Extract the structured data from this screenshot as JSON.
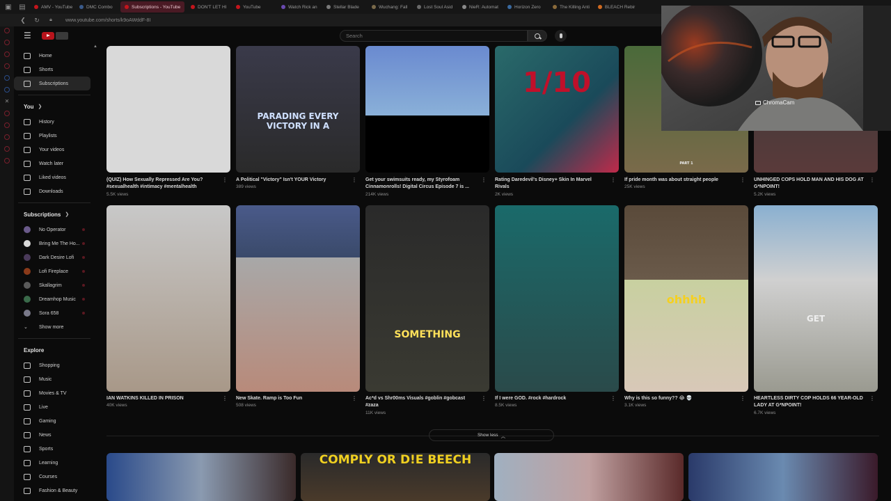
{
  "browser": {
    "tabs": [
      {
        "label": "AMV - YouTube",
        "active": false
      },
      {
        "label": "DMC Combo",
        "active": false
      },
      {
        "label": "Subscriptions - YouTube",
        "active": true
      },
      {
        "label": "DON'T LET HI",
        "active": false
      },
      {
        "label": "YouTube",
        "active": false
      },
      {
        "label": "Watch Rick an",
        "active": false
      },
      {
        "label": "Stellar Blade",
        "active": false
      },
      {
        "label": "Wuchang: Fall",
        "active": false
      },
      {
        "label": "Lost Soul Asid",
        "active": false
      },
      {
        "label": "NieR: Automat",
        "active": false
      },
      {
        "label": "Horizon Zero",
        "active": false
      },
      {
        "label": "The Killing Anti",
        "active": false
      },
      {
        "label": "BLEACH Rebir",
        "active": false
      }
    ],
    "url": "www.youtube.com/shorts/k9oAWddF-8I"
  },
  "header": {
    "search_placeholder": "Search"
  },
  "nav": {
    "main": [
      {
        "label": "Home",
        "icon": "home-icon"
      },
      {
        "label": "Shorts",
        "icon": "shorts-icon"
      },
      {
        "label": "Subscriptions",
        "icon": "subscriptions-icon",
        "selected": true
      }
    ],
    "you_title": "You",
    "you_items": [
      {
        "label": "History",
        "icon": "history-icon"
      },
      {
        "label": "Playlists",
        "icon": "playlists-icon"
      },
      {
        "label": "Your videos",
        "icon": "your-videos-icon"
      },
      {
        "label": "Watch later",
        "icon": "watch-later-icon"
      },
      {
        "label": "Liked videos",
        "icon": "liked-videos-icon"
      },
      {
        "label": "Downloads",
        "icon": "downloads-icon"
      }
    ],
    "subscriptions_title": "Subscriptions",
    "subscriptions": [
      {
        "label": "No Operator",
        "color": "#6a5a8a"
      },
      {
        "label": "Bring Me The Ho...",
        "color": "#d8d8d8"
      },
      {
        "label": "Dark Desire Lofi",
        "color": "#4a3a5a"
      },
      {
        "label": "Lofi Fireplace",
        "color": "#8a3a1a"
      },
      {
        "label": "Skallagrim",
        "color": "#5a5a5a"
      },
      {
        "label": "Dreamhop Music",
        "color": "#3a6a4a"
      },
      {
        "label": "Sora 658",
        "color": "#7a7a8a"
      }
    ],
    "show_more": "Show more",
    "explore_title": "Explore",
    "explore": [
      {
        "label": "Shopping",
        "icon": "shopping-icon"
      },
      {
        "label": "Music",
        "icon": "music-icon"
      },
      {
        "label": "Movies & TV",
        "icon": "movies-icon"
      },
      {
        "label": "Live",
        "icon": "live-icon"
      },
      {
        "label": "Gaming",
        "icon": "gaming-icon"
      },
      {
        "label": "News",
        "icon": "news-icon"
      },
      {
        "label": "Sports",
        "icon": "sports-icon"
      },
      {
        "label": "Learning",
        "icon": "learning-icon"
      },
      {
        "label": "Courses",
        "icon": "courses-icon"
      },
      {
        "label": "Fashion & Beauty",
        "icon": "fashion-icon"
      }
    ]
  },
  "shorts_row1": [
    {
      "title": "(QUIZ) How Sexually Repressed Are You? #sexualhealth #intimacy #mentalhealth",
      "views": "5.5K views",
      "overlay": ""
    },
    {
      "title": "A Political \"Victory\" Isn't YOUR Victory",
      "views": "389 views",
      "overlay": "PARADING EVERY VICTORY IN A"
    },
    {
      "title": "Get your swimsuits ready, my Styrofoam Cinnamonrolls! Digital Circus Episode 7 is ...",
      "views": "214K views",
      "overlay": ""
    },
    {
      "title": "Rating Daredevil's Disney+ Skin In Marvel Rivals",
      "views": "2K views",
      "overlay": "1/10"
    },
    {
      "title": "If pride month was about straight people",
      "views": "25K views",
      "overlay": "PART 1"
    },
    {
      "title": "UNHINGED COPS HOLD MAN AND HIS DOG AT G*NPOINT!",
      "views": "5.2K views",
      "overlay": ""
    }
  ],
  "shorts_row2": [
    {
      "title": "IAN WATKINS KILLED IN PRISON",
      "views": "40K views",
      "overlay": ""
    },
    {
      "title": "New Skate. Ramp is Too Fun",
      "views": "508 views",
      "overlay": ""
    },
    {
      "title": "Ac*d vs Shr00ms Visuals #goblin #gobcast #zaza",
      "views": "11K views",
      "overlay": "SOMETHING"
    },
    {
      "title": "If I were GOD. #rock #hardrock",
      "views": "8.5K views",
      "overlay": ""
    },
    {
      "title": "Why is this so funny?? 😂 💀",
      "views": "3.1K views",
      "overlay": "ohhhh"
    },
    {
      "title": "HEARTLESS DIRTY COP HOLDS 66 YEAR-OLD LADY AT G*NPOINT!",
      "views": "6.7K views",
      "overlay": "GET"
    }
  ],
  "show_less": "Show less",
  "next_row": [
    {
      "overlay": ""
    },
    {
      "overlay": "COMPLY OR D!E BEECH"
    },
    {
      "overlay": ""
    },
    {
      "overlay": ""
    }
  ],
  "webcam": {
    "label": "ChromaCam"
  },
  "colors": {
    "accent_red": "#c4151c",
    "background": "#0b0b0b",
    "active_tab": "#4a1a24"
  }
}
